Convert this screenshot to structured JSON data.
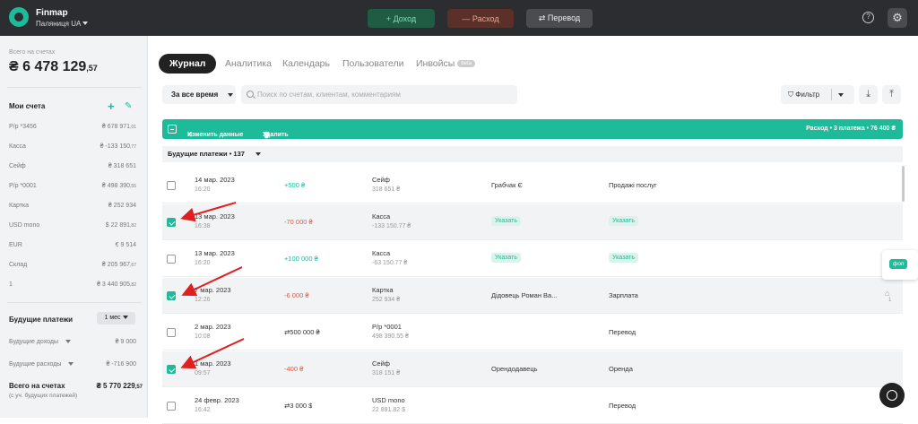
{
  "app": {
    "brand": "Finmap",
    "org": "Паляниця UA"
  },
  "topbar": {
    "income": "+ Доход",
    "expense": "— Расход",
    "transfer": "⇄ Перевод",
    "help_icon": "?",
    "settings_icon": "⚙"
  },
  "sidebar": {
    "total_caption": "Всего на счетах",
    "total_main": "₴ 6 478 129",
    "total_cents": ",57",
    "accounts_title": "Мои счета",
    "accounts": [
      {
        "name": "Р/р *3456",
        "value": "₴ 678 971",
        "cents": ",01"
      },
      {
        "name": "Касса",
        "value": "₴ -133 150",
        "cents": ",77"
      },
      {
        "name": "Сейф",
        "value": "₴ 318 651",
        "cents": ""
      },
      {
        "name": "Р/р *0001",
        "value": "₴ 498 390",
        "cents": ",55"
      },
      {
        "name": "Картка",
        "value": "₴ 252 934",
        "cents": ""
      },
      {
        "name": "USD mono",
        "value": "$ 22 891",
        "cents": ",82"
      },
      {
        "name": "EUR",
        "value": "€ 9 514",
        "cents": ""
      },
      {
        "name": "Склад",
        "value": "₴ 205 967",
        "cents": ",67"
      },
      {
        "name": "1",
        "value": "₴ 3 440 905",
        "cents": ",82"
      }
    ],
    "future_title": "Будущие платежи",
    "period_value": "1 мес",
    "future_income_label": "Будущие доходы",
    "future_income_value": "₴ 9 000",
    "future_expense_label": "Будущие расходы",
    "future_expense_value": "₴ -716 900",
    "future_total_label": "Всего на счетах",
    "future_total_value": "₴ 5 770 229",
    "future_total_cents": ",57",
    "future_total_note": "(с уч. будущих платежей)"
  },
  "tabs": {
    "journal": "Журнал",
    "analytics": "Аналитика",
    "calendar": "Календарь",
    "users": "Пользователи",
    "invoices": "Инвойсы",
    "beta": "beta"
  },
  "toolbar": {
    "period": "За все время",
    "search_placeholder": "Поиск по счетам, клиентам, комментариям",
    "filter": "Фильтр"
  },
  "bulk": {
    "edit": "Изменить данные",
    "delete": "Удалить",
    "summary": "Расход • 3 платежа • 76 400 ₴"
  },
  "group": {
    "label": "Будущие платежи • 137"
  },
  "rows": [
    {
      "date": "14 мар. 2023",
      "time": "16:20",
      "amount": "+500 ₴",
      "kind": "pos",
      "account": "Сейф",
      "balance": "318 651 ₴",
      "counterparty": "Грабчак Є",
      "category": "Продажі послуг",
      "checked": false
    },
    {
      "date": "13 мар. 2023",
      "time": "16:38",
      "amount": "-70 000 ₴",
      "kind": "neg",
      "account": "Касса",
      "balance": "-133 150.77 ₴",
      "counterparty": "Указать",
      "category": "Указать",
      "checked": true
    },
    {
      "date": "13 мар. 2023",
      "time": "16:20",
      "amount": "+100 000 ₴",
      "kind": "pos",
      "account": "Касса",
      "balance": "-63 150.77 ₴",
      "counterparty": "Указать",
      "category": "Указать",
      "checked": false
    },
    {
      "date": "7 мар. 2023",
      "time": "12:26",
      "amount": "-6 000 ₴",
      "kind": "neg",
      "account": "Картка",
      "balance": "252 934 ₴",
      "counterparty": "Дідовець Роман Ва...",
      "category": "Зарплата",
      "checked": true
    },
    {
      "date": "2 мар. 2023",
      "time": "10:08",
      "amount": "⇄500 000 ₴",
      "kind": "neu",
      "account": "Р/р *0001",
      "balance": "498 390.55 ₴",
      "counterparty": "",
      "category": "Перевод",
      "checked": false
    },
    {
      "date": "1 мар. 2023",
      "time": "09:57",
      "amount": "-400 ₴",
      "kind": "neg",
      "account": "Сейф",
      "balance": "318 151 ₴",
      "counterparty": "Орендодавець",
      "category": "Оренда",
      "checked": true
    },
    {
      "date": "24 февр. 2023",
      "time": "16:42",
      "amount": "⇄3 000 $",
      "kind": "neu",
      "account": "USD mono",
      "balance": "22 891.82 $",
      "counterparty": "",
      "category": "Перевод",
      "checked": false
    }
  ],
  "tag_popup": {
    "label": "фоп",
    "count": "1"
  },
  "colors": {
    "accent": "#1dbb99",
    "negative": "#e85a3c",
    "arrow": "#e02020"
  }
}
